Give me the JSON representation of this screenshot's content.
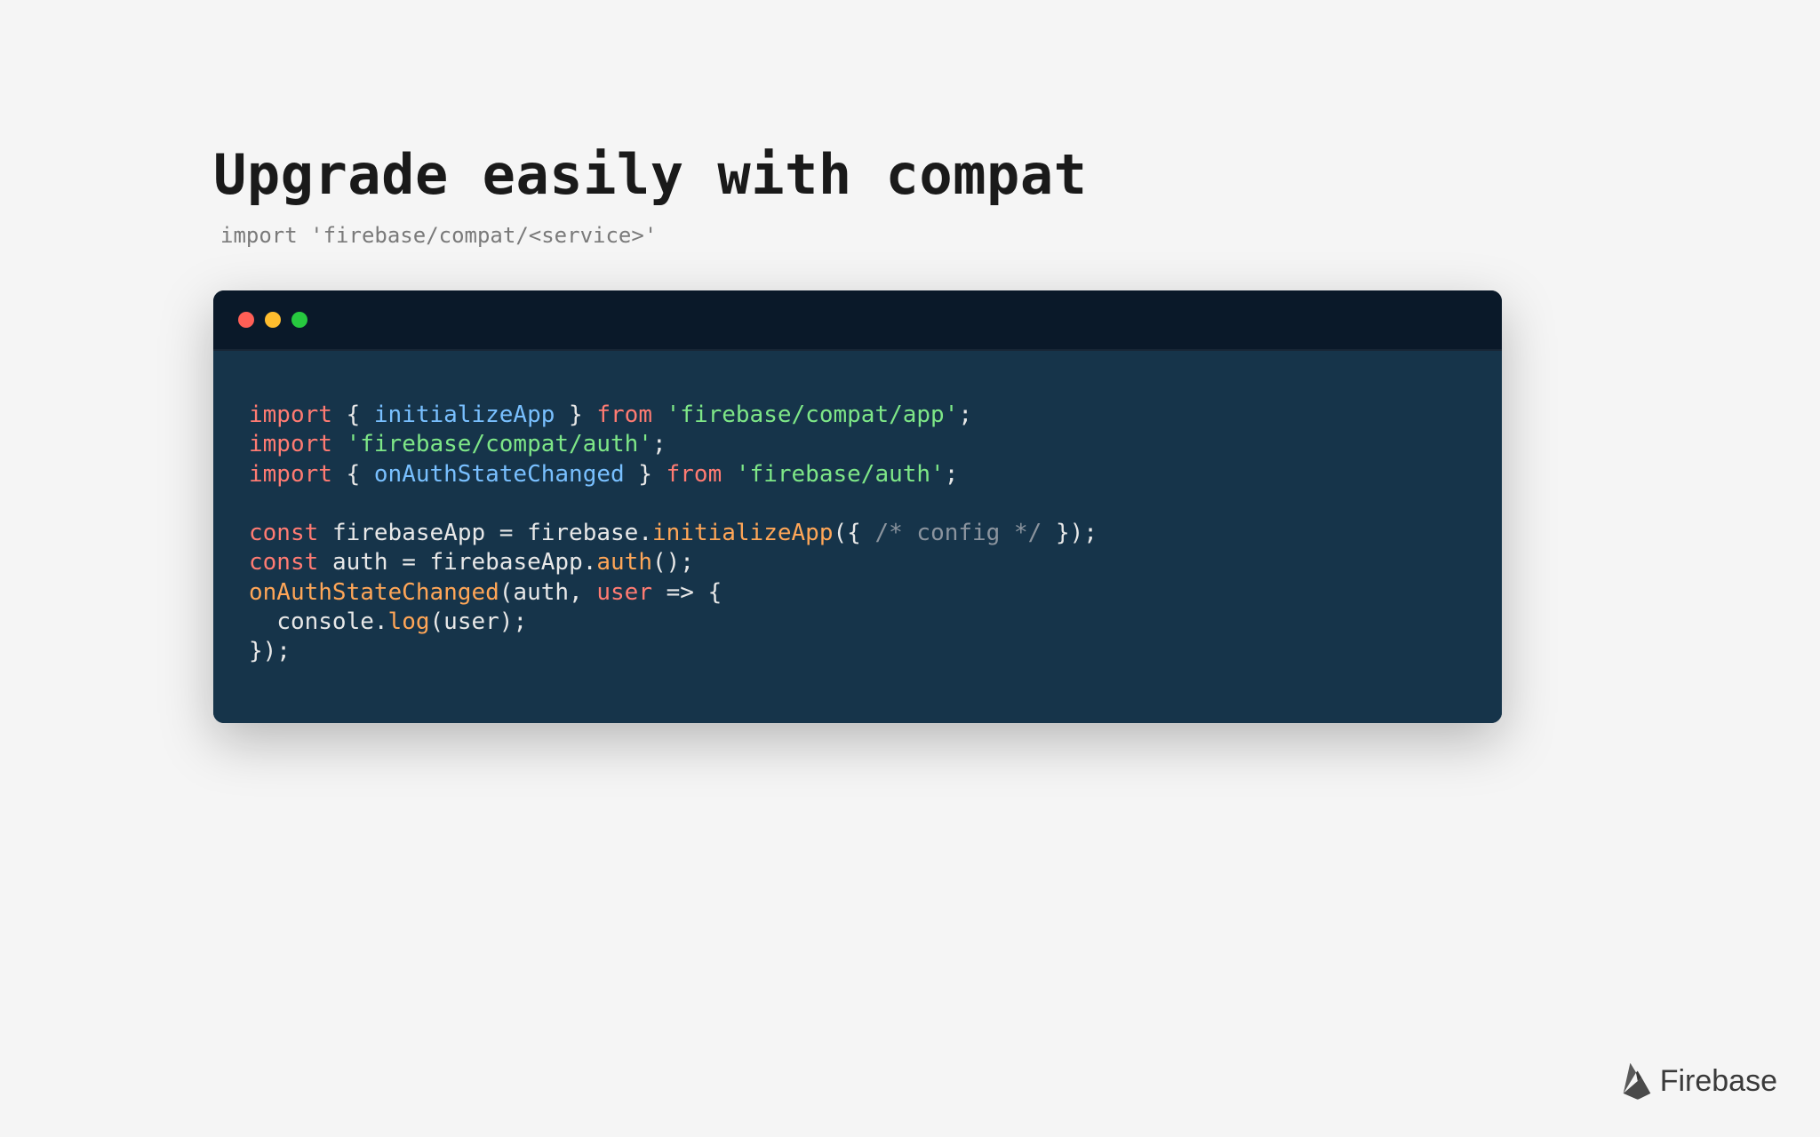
{
  "title": "Upgrade easily with compat",
  "subtitle": "import 'firebase/compat/<service>'",
  "code": {
    "lines": [
      [
        {
          "cls": "tok-kw",
          "t": "import"
        },
        {
          "cls": "tok-default",
          "t": " { "
        },
        {
          "cls": "tok-id",
          "t": "initializeApp"
        },
        {
          "cls": "tok-default",
          "t": " } "
        },
        {
          "cls": "tok-kw",
          "t": "from"
        },
        {
          "cls": "tok-default",
          "t": " "
        },
        {
          "cls": "tok-str",
          "t": "'firebase/compat/app'"
        },
        {
          "cls": "tok-default",
          "t": ";"
        }
      ],
      [
        {
          "cls": "tok-kw",
          "t": "import"
        },
        {
          "cls": "tok-default",
          "t": " "
        },
        {
          "cls": "tok-str",
          "t": "'firebase/compat/auth'"
        },
        {
          "cls": "tok-default",
          "t": ";"
        }
      ],
      [
        {
          "cls": "tok-kw",
          "t": "import"
        },
        {
          "cls": "tok-default",
          "t": " { "
        },
        {
          "cls": "tok-id",
          "t": "onAuthStateChanged"
        },
        {
          "cls": "tok-default",
          "t": " } "
        },
        {
          "cls": "tok-kw",
          "t": "from"
        },
        {
          "cls": "tok-default",
          "t": " "
        },
        {
          "cls": "tok-str",
          "t": "'firebase/auth'"
        },
        {
          "cls": "tok-default",
          "t": ";"
        }
      ],
      [
        {
          "cls": "tok-default",
          "t": " "
        }
      ],
      [
        {
          "cls": "tok-kw",
          "t": "const"
        },
        {
          "cls": "tok-default",
          "t": " "
        },
        {
          "cls": "tok-local",
          "t": "firebaseApp"
        },
        {
          "cls": "tok-default",
          "t": " = "
        },
        {
          "cls": "tok-local",
          "t": "firebase"
        },
        {
          "cls": "tok-default",
          "t": "."
        },
        {
          "cls": "tok-method",
          "t": "initializeApp"
        },
        {
          "cls": "tok-default",
          "t": "({ "
        },
        {
          "cls": "tok-comment",
          "t": "/* config */"
        },
        {
          "cls": "tok-default",
          "t": " });"
        }
      ],
      [
        {
          "cls": "tok-kw",
          "t": "const"
        },
        {
          "cls": "tok-default",
          "t": " "
        },
        {
          "cls": "tok-local",
          "t": "auth"
        },
        {
          "cls": "tok-default",
          "t": " = "
        },
        {
          "cls": "tok-local",
          "t": "firebaseApp"
        },
        {
          "cls": "tok-default",
          "t": "."
        },
        {
          "cls": "tok-method",
          "t": "auth"
        },
        {
          "cls": "tok-default",
          "t": "();"
        }
      ],
      [
        {
          "cls": "tok-method",
          "t": "onAuthStateChanged"
        },
        {
          "cls": "tok-default",
          "t": "("
        },
        {
          "cls": "tok-local",
          "t": "auth"
        },
        {
          "cls": "tok-default",
          "t": ", "
        },
        {
          "cls": "tok-kw",
          "t": "user"
        },
        {
          "cls": "tok-default",
          "t": " => {"
        }
      ],
      [
        {
          "cls": "tok-default",
          "t": "  "
        },
        {
          "cls": "tok-local",
          "t": "console"
        },
        {
          "cls": "tok-default",
          "t": "."
        },
        {
          "cls": "tok-method",
          "t": "log"
        },
        {
          "cls": "tok-default",
          "t": "("
        },
        {
          "cls": "tok-local",
          "t": "user"
        },
        {
          "cls": "tok-default",
          "t": ");"
        }
      ],
      [
        {
          "cls": "tok-default",
          "t": "});"
        }
      ]
    ]
  },
  "footer": {
    "brand": "Firebase"
  }
}
